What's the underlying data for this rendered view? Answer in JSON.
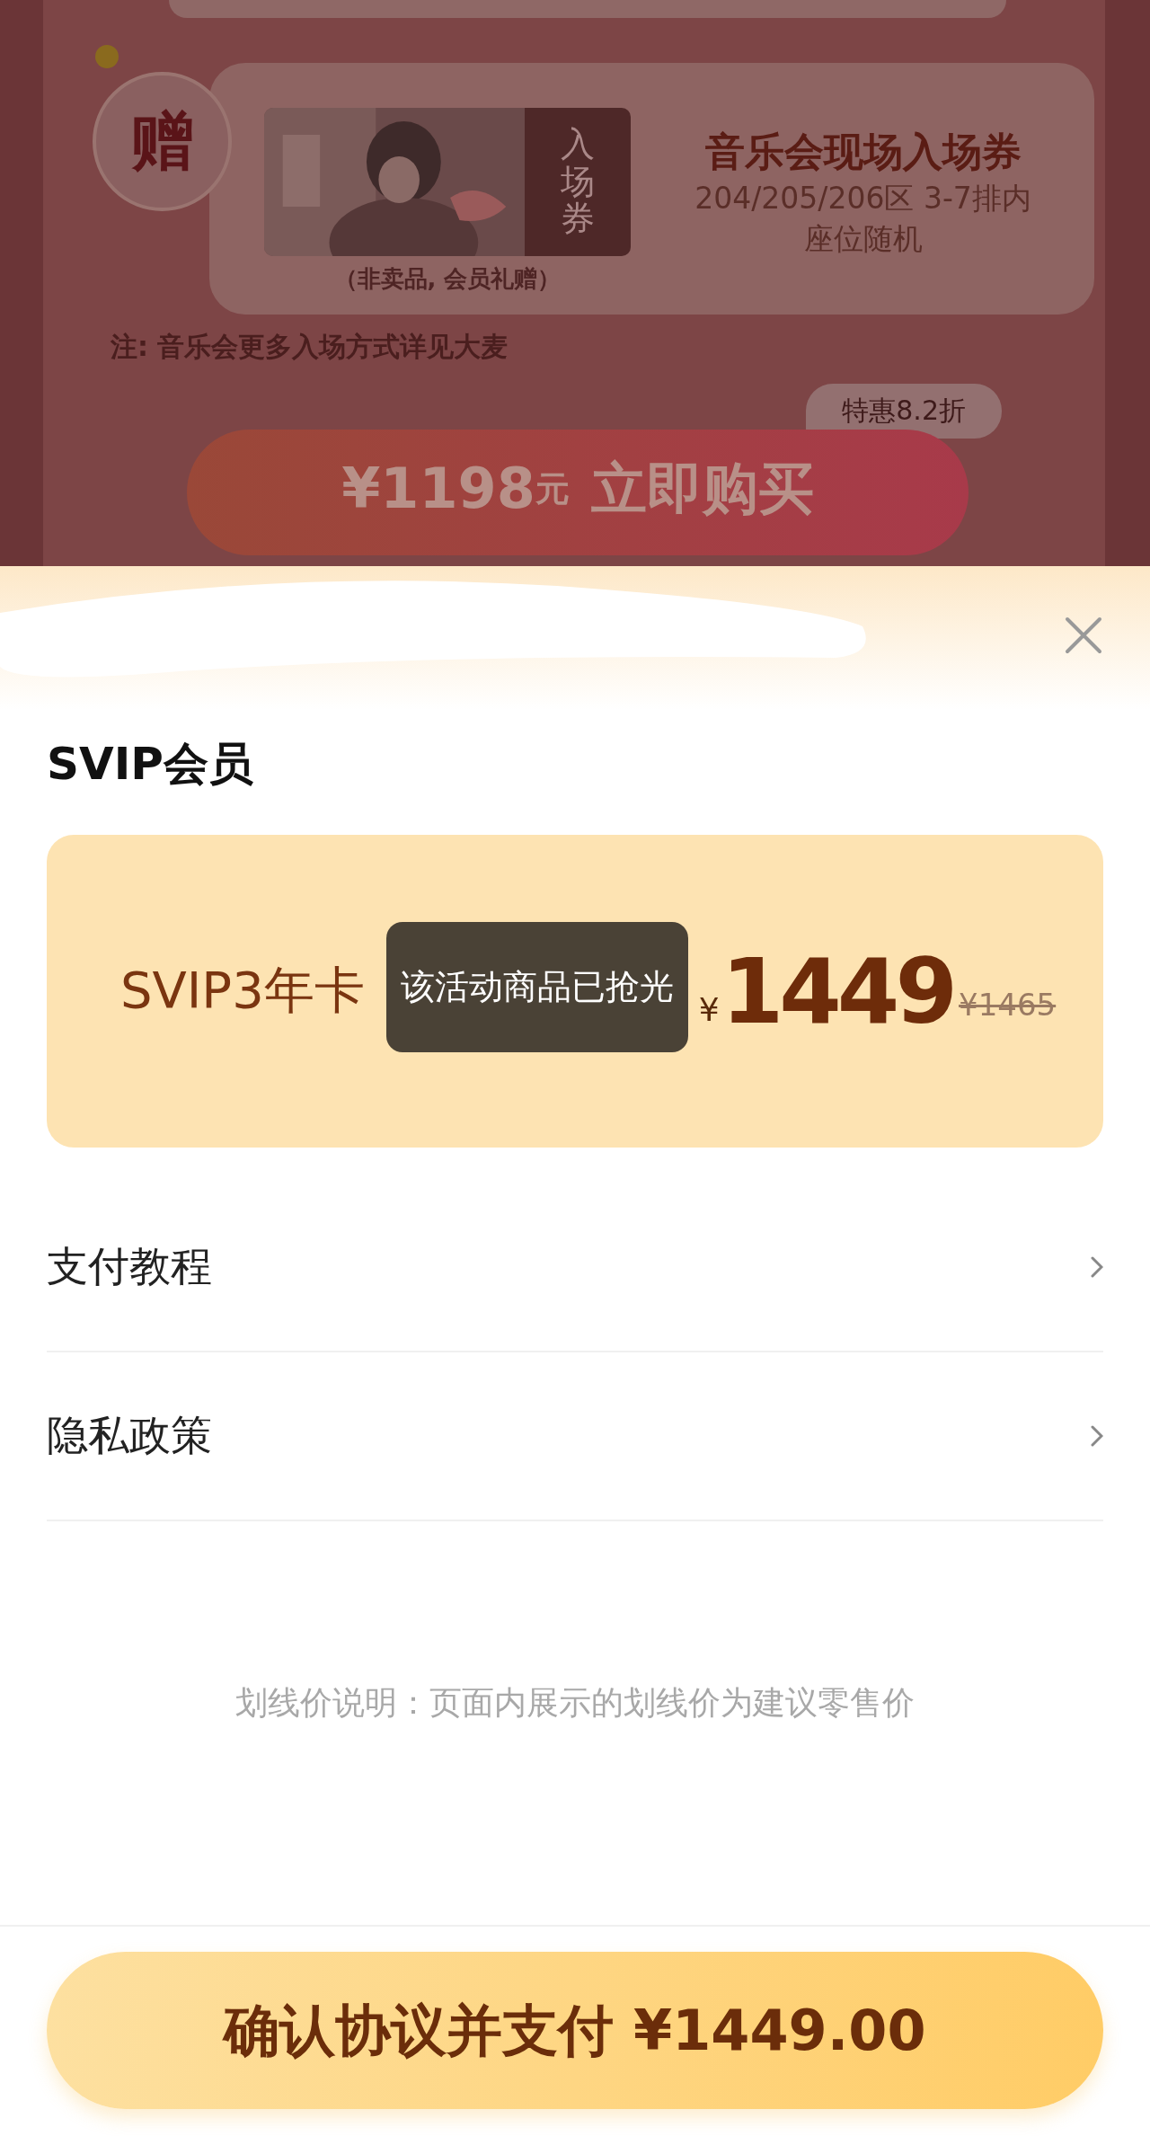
{
  "promo": {
    "gift_badge": "赠",
    "ticket_stub": "入场券",
    "gift_title": "音乐会现场入场券",
    "gift_detail_1": "204/205/206区 3-7排内",
    "gift_detail_2": "座位随机",
    "gift_caption": "（非卖品, 会员礼赠）",
    "note": "注: 音乐会更多入场方式详见大麦",
    "discount_badge": "特惠8.2折",
    "buy_button": {
      "price": "¥1198",
      "unit": "元",
      "action": "立即购买"
    }
  },
  "sheet": {
    "section_title": "SVIP会员",
    "plan": {
      "name": "SVIP3年卡",
      "currency": "¥",
      "price": "1449",
      "original_price": "¥1465",
      "selected": true
    },
    "toast": "该活动商品已抢光",
    "links": [
      {
        "label": "支付教程"
      },
      {
        "label": "隐私政策"
      }
    ],
    "price_note": "划线价说明：页面内展示的划线价为建议零售价",
    "pay_button": "确认协议并支付 ¥1449.00"
  }
}
